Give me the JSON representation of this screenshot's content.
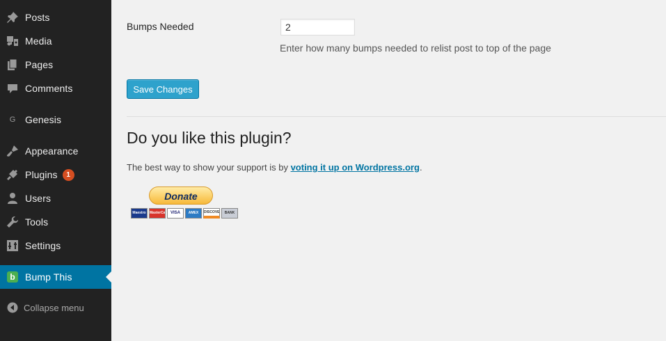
{
  "sidebar": {
    "items": [
      {
        "label": "Posts",
        "icon": "pushpin-icon"
      },
      {
        "label": "Media",
        "icon": "media-icon"
      },
      {
        "label": "Pages",
        "icon": "pages-icon"
      },
      {
        "label": "Comments",
        "icon": "comment-icon"
      },
      {
        "label": "Genesis",
        "icon": "genesis-icon",
        "icon_text": "G"
      },
      {
        "label": "Appearance",
        "icon": "paintbrush-icon"
      },
      {
        "label": "Plugins",
        "icon": "plug-icon",
        "badge": "1"
      },
      {
        "label": "Users",
        "icon": "user-icon"
      },
      {
        "label": "Tools",
        "icon": "wrench-icon"
      },
      {
        "label": "Settings",
        "icon": "settings-icon"
      },
      {
        "label": "Bump This",
        "icon": "bump-this-icon",
        "icon_text": "b",
        "current": true
      }
    ],
    "collapse_label": "Collapse menu"
  },
  "form": {
    "bumps_label": "Bumps Needed",
    "bumps_value": "2",
    "bumps_description": "Enter how many bumps needed to relist post to top of the page",
    "save_label": "Save Changes"
  },
  "promo": {
    "heading": "Do you like this plugin?",
    "support_text": "The best way to show your support is by ",
    "support_link": "voting it up on Wordpress.org",
    "support_end": ".",
    "donate_label": "Donate",
    "cards": [
      "Maestro",
      "MasterCard",
      "VISA",
      "AMEX",
      "DISCOVER",
      "BANK"
    ]
  },
  "colors": {
    "sidebar_bg": "#222222",
    "current_bg": "#0074a2",
    "button_bg": "#2ea2cc",
    "badge_bg": "#d54e21",
    "link": "#0074a2"
  }
}
